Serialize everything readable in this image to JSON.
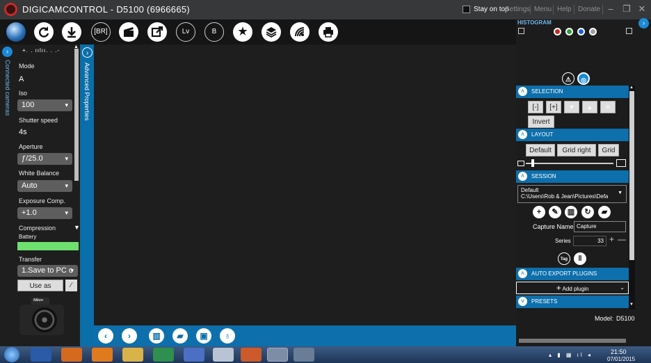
{
  "window": {
    "title": "DIGICAMCONTROL - D5100 (6966665)",
    "stay_on_top": "Stay on top",
    "links": [
      "Settings",
      "Menu",
      "Help",
      "Donate"
    ],
    "min_glyph": "–",
    "max_glyph": "❐",
    "close_glyph": "✕"
  },
  "toolbar": {
    "br_label": "[BR]",
    "lv_label": "Lv",
    "b_label": "B"
  },
  "left_tabs": {
    "connected": "Connected cameras",
    "advanced": "Advanced Properties"
  },
  "left_panel": {
    "exposure_scale": "+. . ıılıı. . .-",
    "mode_label": "Mode",
    "mode_value": "A",
    "iso_label": "Iso",
    "iso_value": "100",
    "shutter_label": "Shutter speed",
    "shutter_value": "4s",
    "aperture_label": "Aperture",
    "aperture_value": "ƒ/25.0",
    "wb_label": "White Balance",
    "wb_value": "Auto",
    "expcomp_label": "Exposure Comp.",
    "expcomp_value": "+1.0",
    "compression_label": "Compression",
    "battery_label": "Battery",
    "battery_level": 100,
    "transfer_label": "Transfer",
    "transfer_value": "1.Save to PC o",
    "master_button": "Use as master",
    "camera_brand": "Nikon"
  },
  "right_panel": {
    "histogram_label": "HISTOGRAM",
    "colors": {
      "red": "#c62828",
      "green": "#2e9e3a",
      "blue": "#1e5fd8",
      "gray": "#9e9e9e",
      "accent": "#0d6fab"
    },
    "selection_label": "SELECTION",
    "sel_minus": "[-]",
    "sel_plus": "[+]",
    "invert_label": "Invert",
    "layout_label": "LAYOUT",
    "layout_buttons": [
      "Default",
      "Grid right",
      "Grid"
    ],
    "session_label": "SESSION",
    "session_name": "Default",
    "session_path": "C:\\Users\\Rob & Jean\\Pictures\\Defa",
    "capture_name_label": "Capture Name",
    "capture_name_value": "Capture",
    "series_label": "Series",
    "series_value": "33",
    "tag_label": "Tag",
    "auto_export_label": "AUTO EXPORT PLUGINS",
    "add_plugin_label": "Add plugin",
    "presets_label": "PRESETS",
    "model_label": "Model:",
    "model_value": "D5100"
  },
  "taskbar": {
    "time": "21:50",
    "date": "07/01/2015"
  }
}
